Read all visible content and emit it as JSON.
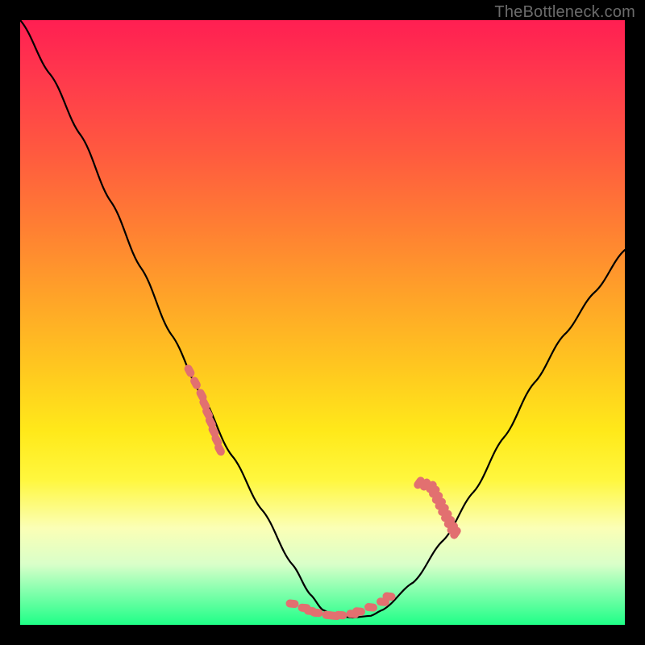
{
  "watermark": "TheBottleneck.com",
  "chart_data": {
    "type": "line",
    "title": "",
    "xlabel": "",
    "ylabel": "",
    "xlim": [
      0,
      100
    ],
    "ylim": [
      0,
      100
    ],
    "grid": false,
    "series": [
      {
        "name": "bottleneck-curve",
        "color": "#000000",
        "x": [
          0,
          5,
          10,
          15,
          20,
          25,
          30,
          35,
          40,
          45,
          48,
          50,
          52,
          55,
          58,
          60,
          65,
          70,
          75,
          80,
          85,
          90,
          95,
          100
        ],
        "y": [
          100,
          91,
          81,
          70,
          59,
          48,
          38,
          28,
          19,
          10,
          5,
          2.5,
          1.5,
          1.2,
          1.5,
          2.5,
          7,
          14,
          22,
          31,
          40,
          48,
          55,
          62
        ]
      }
    ],
    "markers": {
      "name": "highlighted-points",
      "color": "#e27070",
      "left_cluster": {
        "x": [
          28,
          29,
          30,
          30.5,
          31,
          31.5,
          32,
          32.5,
          33
        ],
        "y": [
          42,
          40,
          38,
          36.5,
          35,
          33.5,
          32,
          30.5,
          29
        ]
      },
      "bottom_cluster": {
        "x": [
          45,
          47,
          48,
          49,
          51,
          52,
          53,
          55,
          56,
          58,
          60,
          61
        ],
        "y": [
          3.5,
          2.8,
          2.3,
          2.0,
          1.6,
          1.5,
          1.6,
          1.8,
          2.2,
          2.9,
          3.8,
          4.7
        ]
      },
      "right_cluster": {
        "x": [
          66,
          67,
          68,
          68.5,
          69,
          69.5,
          70,
          70.5,
          71,
          71.5,
          72
        ],
        "y": [
          23.5,
          23.2,
          22.8,
          22.0,
          21.0,
          20.0,
          19.0,
          18.0,
          17.0,
          16.0,
          15.2
        ]
      }
    },
    "background_gradient": {
      "top": "#ff1f52",
      "mid": "#ffe91a",
      "bottom": "#1fff87"
    }
  }
}
